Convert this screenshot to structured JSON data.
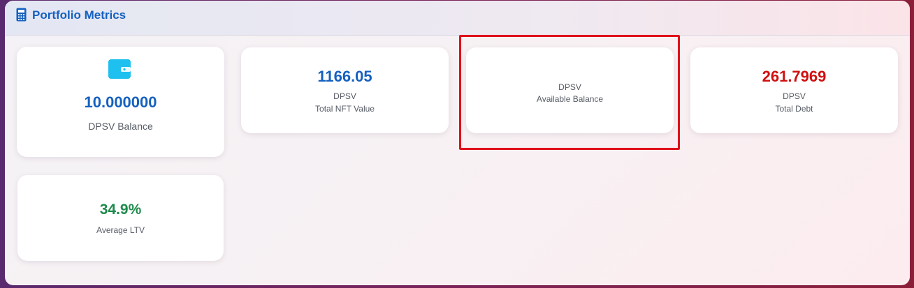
{
  "header": {
    "title": "Portfolio Metrics",
    "icon": "calculator-icon"
  },
  "cards": {
    "balance": {
      "value": "10.000000",
      "label": "DPSV Balance",
      "icon": "wallet-icon",
      "color": "#1560c0"
    },
    "nft": {
      "value": "1166.05",
      "unit": "DPSV",
      "label": "Total NFT Value",
      "color": "#1560c0"
    },
    "available": {
      "value": "",
      "unit": "DPSV",
      "label": "Available Balance"
    },
    "debt": {
      "value": "261.7969",
      "unit": "DPSV",
      "label": "Total Debt",
      "color": "#d01010"
    },
    "ltv": {
      "value": "34.9%",
      "label": "Average LTV",
      "color": "#1e8a4c"
    }
  },
  "colors": {
    "accent": "#1560c0",
    "highlight": "#e0101a",
    "wallet_icon": "#1ec0ef"
  }
}
